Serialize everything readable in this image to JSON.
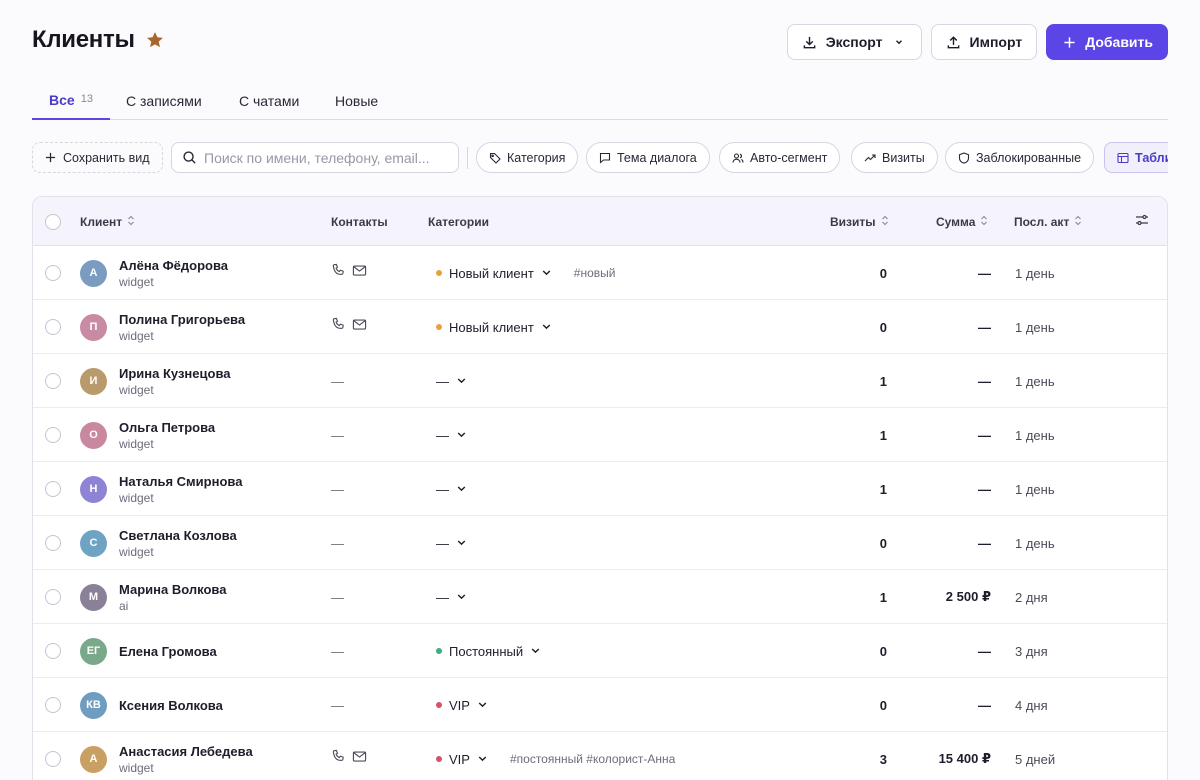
{
  "header": {
    "title": "Клиенты",
    "star_color": "#a5662f",
    "buttons": {
      "export": "Экспорт",
      "import": "Импорт",
      "add": "Добавить"
    }
  },
  "tabs": [
    {
      "label": "Все",
      "count": "13",
      "active": true
    },
    {
      "label": "С записями"
    },
    {
      "label": "С чатами"
    },
    {
      "label": "Новые"
    }
  ],
  "toolbar": {
    "save_view": "Сохранить вид",
    "search_placeholder": "Поиск по имени, телефону, email...",
    "filters": [
      "Категория",
      "Тема диалога",
      "Авто-сегмент",
      "Визиты",
      "Заблокированные"
    ],
    "view_button": "Табли"
  },
  "table": {
    "columns": {
      "client": "Клиент",
      "contacts": "Контакты",
      "categories": "Категории",
      "visits": "Визиты",
      "sum": "Сумма",
      "last_activity": "Посл. акт"
    },
    "rows": [
      {
        "initials": "А",
        "avatar_color": "#7b9bc0",
        "name": "Алёна Фёдорова",
        "source": "widget",
        "contacts": "icons",
        "category": "Новый клиент",
        "category_color": "#e8a23b",
        "tags": "#новый",
        "visits": "0",
        "sum": "—",
        "last": "1 день"
      },
      {
        "initials": "П",
        "avatar_color": "#c98aa4",
        "name": "Полина Григорьева",
        "source": "widget",
        "contacts": "icons",
        "category": "Новый клиент",
        "category_color": "#e8a23b",
        "tags": "",
        "visits": "0",
        "sum": "—",
        "last": "1 день"
      },
      {
        "initials": "И",
        "avatar_color": "#b99a6c",
        "name": "Ирина Кузнецова",
        "source": "widget",
        "contacts": "—",
        "category": "—",
        "category_color": "",
        "tags": "",
        "visits": "1",
        "sum": "—",
        "last": "1 день"
      },
      {
        "initials": "О",
        "avatar_color": "#c9889f",
        "name": "Ольга Петрова",
        "source": "widget",
        "contacts": "—",
        "category": "—",
        "category_color": "",
        "tags": "",
        "visits": "1",
        "sum": "—",
        "last": "1 день"
      },
      {
        "initials": "Н",
        "avatar_color": "#8d84d6",
        "name": "Наталья Смирнова",
        "source": "widget",
        "contacts": "—",
        "category": "—",
        "category_color": "",
        "tags": "",
        "visits": "1",
        "sum": "—",
        "last": "1 день"
      },
      {
        "initials": "С",
        "avatar_color": "#6fa3c4",
        "name": "Светлана Козлова",
        "source": "widget",
        "contacts": "—",
        "category": "—",
        "category_color": "",
        "tags": "",
        "visits": "0",
        "sum": "—",
        "last": "1 день"
      },
      {
        "initials": "М",
        "avatar_color": "#8a8198",
        "name": "Марина Волкова",
        "source": "ai",
        "contacts": "—",
        "category": "—",
        "category_color": "",
        "tags": "",
        "visits": "1",
        "sum": "2 500 ₽",
        "last": "2 дня"
      },
      {
        "initials": "ЕГ",
        "avatar_color": "#7aa88a",
        "name": "Елена Громова",
        "source": "",
        "contacts": "—",
        "category": "Постоянный",
        "category_color": "#3fae7c",
        "tags": "",
        "visits": "0",
        "sum": "—",
        "last": "3 дня"
      },
      {
        "initials": "КВ",
        "avatar_color": "#6f9dbf",
        "name": "Ксения Волкова",
        "source": "",
        "contacts": "—",
        "category": "VIP",
        "category_color": "#d9506a",
        "tags": "",
        "visits": "0",
        "sum": "—",
        "last": "4 дня"
      },
      {
        "initials": "А",
        "avatar_color": "#c9a063",
        "name": "Анастасия Лебедева",
        "source": "widget",
        "contacts": "icons",
        "category": "VIP",
        "category_color": "#d9506a",
        "tags": "#постоянный  #колорист-Анна",
        "visits": "3",
        "sum": "15 400 ₽",
        "last": "5 дней"
      }
    ]
  }
}
